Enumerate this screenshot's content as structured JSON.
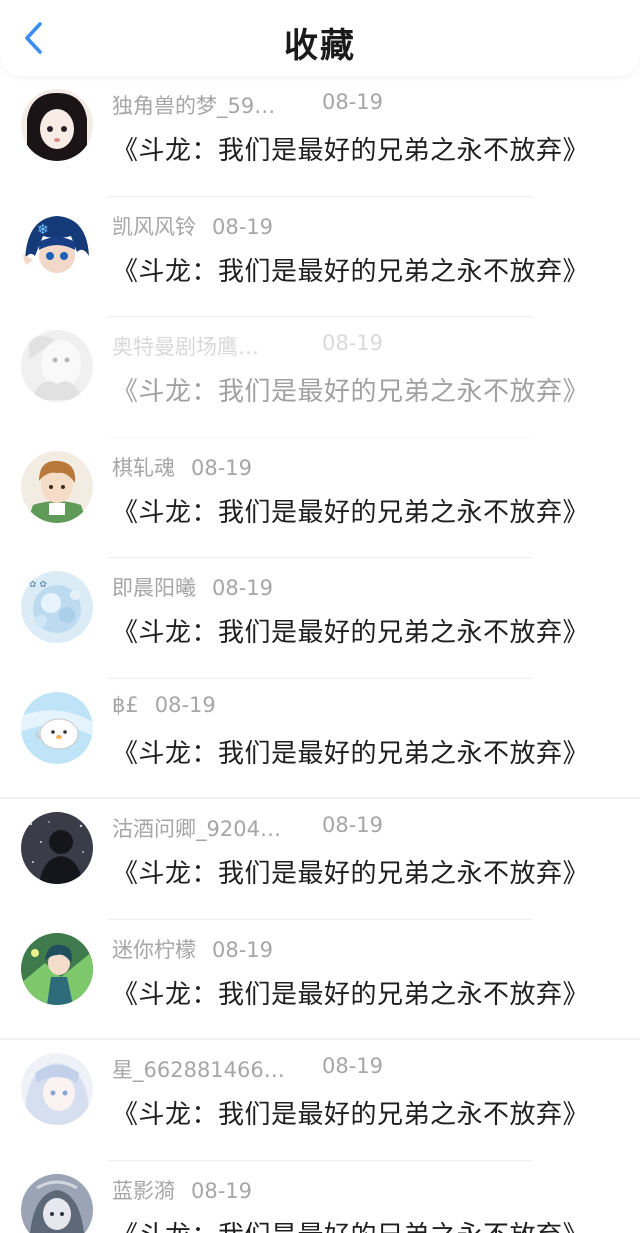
{
  "header": {
    "title": "收藏",
    "back_icon": "chevron-left-icon",
    "accent": "#3a8ef0"
  },
  "items": [
    {
      "name": "独角兽的梦_59…",
      "date": "08-19",
      "text": "《斗龙：我们是最好的兄弟之永不放弃》",
      "avatar_icon": "avatar-anime-girl-dark-hair",
      "faded": false
    },
    {
      "name": "凯风风铃",
      "date": "08-19",
      "text": "《斗龙：我们是最好的兄弟之永不放弃》",
      "avatar_icon": "avatar-anime-blue-hair",
      "faded": false
    },
    {
      "name": "奥特曼剧场鹰…",
      "date": "08-19",
      "text": "《斗龙：我们是最好的兄弟之永不放弃》",
      "avatar_icon": "avatar-grey-sketch",
      "faded": true
    },
    {
      "name": "棋轧魂",
      "date": "08-19",
      "text": "《斗龙：我们是最好的兄弟之永不放弃》",
      "avatar_icon": "avatar-anime-boy-green",
      "faded": false
    },
    {
      "name": "即晨阳曦",
      "date": "08-19",
      "text": "《斗龙：我们是最好的兄弟之永不放弃》",
      "avatar_icon": "avatar-light-blue-bubble",
      "faded": false
    },
    {
      "name": "฿£",
      "date": "08-19",
      "text": "《斗龙：我们是最好的兄弟之永不放弃》",
      "avatar_icon": "avatar-white-chick",
      "faded": false
    },
    {
      "name": "沽酒问卿_9204…",
      "date": "08-19",
      "text": "《斗龙：我们是最好的兄弟之永不放弃》",
      "avatar_icon": "avatar-dark-starry",
      "faded": false
    },
    {
      "name": "迷你柠檬",
      "date": "08-19",
      "text": "《斗龙：我们是最好的兄弟之永不放弃》",
      "avatar_icon": "avatar-green-character",
      "faded": false
    },
    {
      "name": "星_662881466…",
      "date": "08-19",
      "text": "《斗龙：我们是最好的兄弟之永不放弃》",
      "avatar_icon": "avatar-pale-blue-anime",
      "faded": false
    },
    {
      "name": "蓝影漪",
      "date": "08-19",
      "text": "《斗龙：我们是最好的兄弟之永不放弃》",
      "avatar_icon": "avatar-grey-blue-anime",
      "faded": false
    }
  ]
}
